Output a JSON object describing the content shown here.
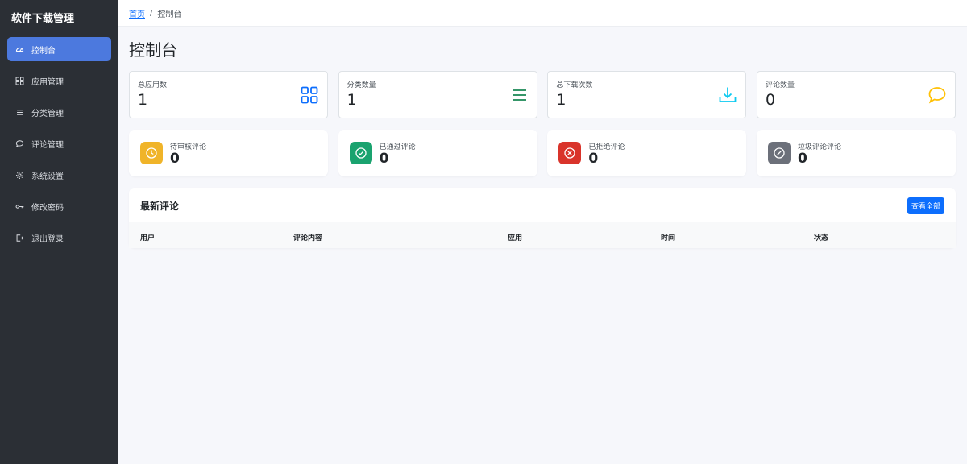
{
  "app": {
    "title": "软件下载管理"
  },
  "sidebar": {
    "items": [
      {
        "label": "控制台",
        "icon": "gauge-icon",
        "active": true
      },
      {
        "label": "应用管理",
        "icon": "grid-icon"
      },
      {
        "label": "分类管理",
        "icon": "list-icon"
      },
      {
        "label": "评论管理",
        "icon": "chat-icon"
      },
      {
        "label": "系统设置",
        "icon": "gear-icon"
      },
      {
        "label": "修改密码",
        "icon": "key-icon"
      },
      {
        "label": "退出登录",
        "icon": "logout-icon"
      }
    ]
  },
  "breadcrumb": {
    "home": "首页",
    "separator": "/",
    "current": "控制台"
  },
  "page": {
    "title": "控制台"
  },
  "stats": [
    {
      "label": "总应用数",
      "value": "1",
      "icon": "grid-icon",
      "color": "#0d6efd"
    },
    {
      "label": "分类数量",
      "value": "1",
      "icon": "list-icon",
      "color": "#198754"
    },
    {
      "label": "总下载次数",
      "value": "1",
      "icon": "download-icon",
      "color": "#0dcaf0"
    },
    {
      "label": "评论数量",
      "value": "0",
      "icon": "chat-icon",
      "color": "#ffc107"
    }
  ],
  "review_stats": [
    {
      "label": "待审核评论",
      "value": "0",
      "icon": "clock-icon",
      "color": "#f0b429"
    },
    {
      "label": "已通过评论",
      "value": "0",
      "icon": "check-circle-icon",
      "color": "#1aa36f"
    },
    {
      "label": "已拒绝评论",
      "value": "0",
      "icon": "x-circle-icon",
      "color": "#d9342b"
    },
    {
      "label": "垃圾评论评论",
      "value": "0",
      "icon": "slash-circle-icon",
      "color": "#6c707a"
    }
  ],
  "latest_comments": {
    "title": "最新评论",
    "view_all": "查看全部",
    "columns": [
      "用户",
      "评论内容",
      "应用",
      "时间",
      "状态"
    ]
  }
}
